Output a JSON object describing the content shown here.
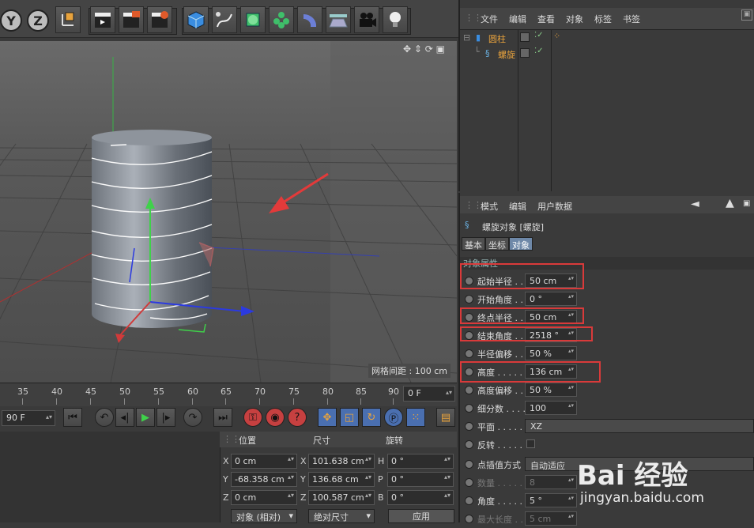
{
  "toolbar": {
    "axis_y": "Y",
    "axis_z": "Z"
  },
  "viewport": {
    "grid_spacing": "网格间距 : 100 cm"
  },
  "timeline": {
    "ticks": [
      "35",
      "40",
      "45",
      "50",
      "55",
      "60",
      "65",
      "70",
      "75",
      "80",
      "85",
      "90"
    ],
    "end_frame": "0 F",
    "start_frame": "90 F"
  },
  "object_manager": {
    "menu": [
      "文件",
      "编辑",
      "查看",
      "对象",
      "标签",
      "书签"
    ],
    "objects": [
      {
        "name": "圆柱"
      },
      {
        "name": "螺旋"
      }
    ]
  },
  "attribute_manager": {
    "menu": [
      "模式",
      "编辑",
      "用户数据"
    ],
    "title": "螺旋对象 [螺旋]",
    "tabs": [
      "基本",
      "坐标",
      "对象"
    ],
    "section": "对象属性",
    "params": [
      {
        "label": "起始半径 . .",
        "value": "50 cm"
      },
      {
        "label": "开始角度 . .",
        "value": "0 °"
      },
      {
        "label": "终点半径 . .",
        "value": "50 cm"
      },
      {
        "label": "结束角度 . .",
        "value": "2518 °"
      },
      {
        "label": "半径偏移 . .",
        "value": "50 %"
      },
      {
        "label": "高度 . . . . .",
        "value": "136 cm"
      },
      {
        "label": "高度偏移 . .",
        "value": "50 %"
      },
      {
        "label": "细分数 . . . .",
        "value": "100"
      },
      {
        "label": "平面 . . . . .",
        "value": "XZ"
      },
      {
        "label": "反转 . . . . .",
        "value": ""
      },
      {
        "label": "点插值方式",
        "value": "自动适应"
      },
      {
        "label": "数量 . . . . .",
        "value": "8"
      },
      {
        "label": "角度 . . . . .",
        "value": "5 °"
      },
      {
        "label": "最大长度 . .",
        "value": "5 cm"
      }
    ]
  },
  "coord_manager": {
    "headers": [
      "位置",
      "尺寸",
      "旋转"
    ],
    "rows": [
      {
        "a": "X",
        "pos": "0 cm",
        "b": "X",
        "size": "101.638 cm",
        "c": "H",
        "rot": "0 °"
      },
      {
        "a": "Y",
        "pos": "-68.358 cm",
        "b": "Y",
        "size": "136.68 cm",
        "c": "P",
        "rot": "0 °"
      },
      {
        "a": "Z",
        "pos": "0 cm",
        "b": "Z",
        "size": "100.587 cm",
        "c": "B",
        "rot": "0 °"
      }
    ],
    "mode": "对象 (相对)",
    "size_mode": "绝对尺寸",
    "apply": "应用"
  },
  "watermark": {
    "brand": "Bai 经验",
    "url": "jingyan.baidu.com"
  },
  "colors": {
    "highlight": "#d93a3a",
    "object_name": "#e8a33d",
    "active_tab": "#6e88a8"
  }
}
